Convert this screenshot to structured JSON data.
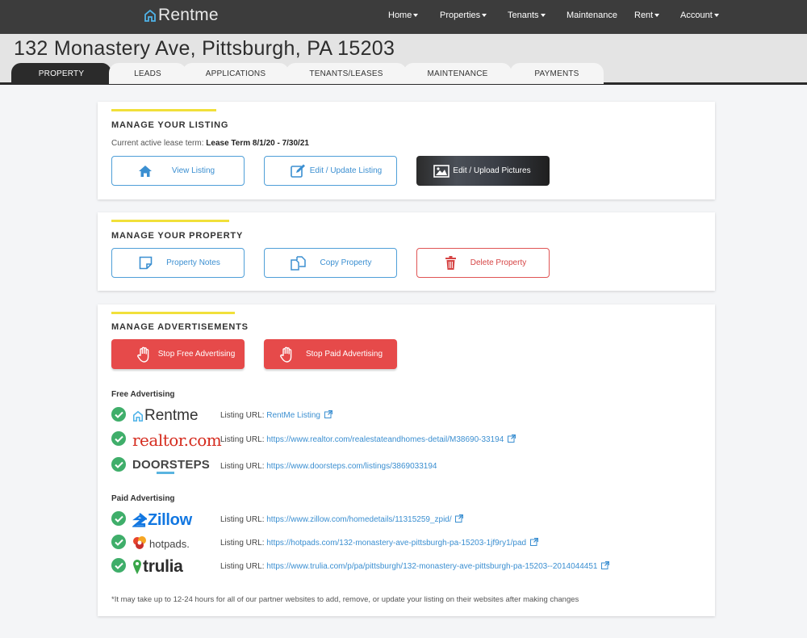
{
  "nav": {
    "brand": "Rentme",
    "items": [
      "Home",
      "Properties",
      "Tenants",
      "Maintenance",
      "Rent",
      "Account"
    ]
  },
  "page": {
    "title": "132 Monastery Ave, Pittsburgh, PA 15203",
    "tabs": [
      "PROPERTY",
      "LEADS",
      "APPLICATIONS",
      "TENANTS/LEASES",
      "MAINTENANCE",
      "PAYMENTS"
    ],
    "active_tab": "PROPERTY"
  },
  "listing": {
    "title": "MANAGE YOUR LISTING",
    "lease_label": "Current active lease term:",
    "lease_value": "Lease Term 8/1/20 - 7/30/21",
    "view": "View Listing",
    "edit": "Edit / Update Listing",
    "pictures": "Edit / Upload Pictures"
  },
  "property": {
    "title": "MANAGE YOUR PROPERTY",
    "notes": "Property Notes",
    "copy": "Copy Property",
    "delete": "Delete Property"
  },
  "ads": {
    "title": "MANAGE ADVERTISEMENTS",
    "stop_free": "Stop Free Advertising",
    "stop_paid": "Stop Paid Advertising",
    "free_heading": "Free Advertising",
    "paid_heading": "Paid Advertising",
    "url_label": "Listing URL:",
    "free": [
      {
        "brand": "Rentme",
        "url": "RentMe Listing"
      },
      {
        "brand": "realtor.com",
        "url": "https://www.realtor.com/realestateandhomes-detail/M38690-33194"
      },
      {
        "brand": "DOORSTEPS",
        "url": "https://www.doorsteps.com/listings/3869033194"
      }
    ],
    "paid": [
      {
        "brand": "Zillow",
        "url": "https://www.zillow.com/homedetails/11315259_zpid/"
      },
      {
        "brand": "hotpads.",
        "url": "https://hotpads.com/132-monastery-ave-pittsburgh-pa-15203-1jf9ry1/pad"
      },
      {
        "brand": "trulia",
        "url": "https://www.trulia.com/p/pa/pittsburgh/132-monastery-ave-pittsburgh-pa-15203--2014044451"
      }
    ],
    "footnote": "*It may take up to 12-24 hours for all of our partner websites to add, remove, or update your listing on their websites after making changes"
  },
  "colors": {
    "accent_yellow": "#f1e03a",
    "blue": "#3b8fd1",
    "red": "#e64a4a",
    "green": "#3fae6a",
    "nav_bg": "#3c3c3c"
  }
}
